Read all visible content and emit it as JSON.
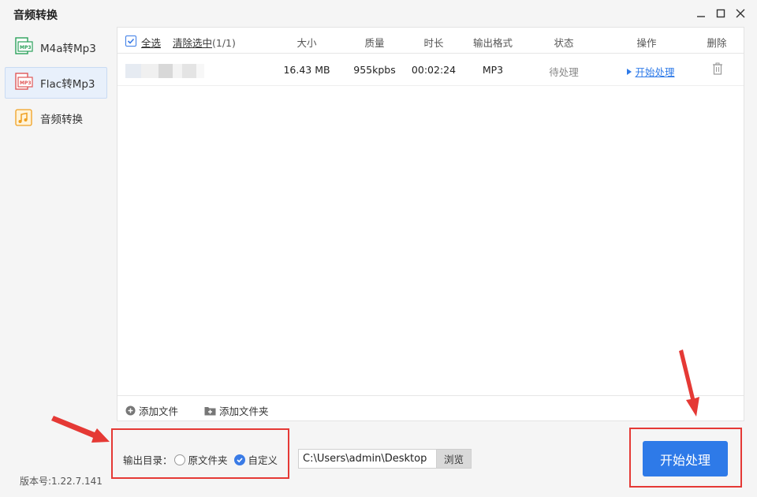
{
  "app": {
    "title": "音频转换"
  },
  "window": {
    "minimize": "minimize-icon",
    "maximize": "maximize-icon",
    "close": "close-icon"
  },
  "sidebar": {
    "items": [
      {
        "label": "M4a转Mp3",
        "icon": "mp3-file-icon",
        "active": false
      },
      {
        "label": "Flac转Mp3",
        "icon": "mp3-file-icon",
        "active": true
      },
      {
        "label": "音频转换",
        "icon": "music-note-icon",
        "active": false
      }
    ]
  },
  "table": {
    "select_all": "全选",
    "clear_selected": "清除选中",
    "selected_count": "(1/1)",
    "columns": [
      "大小",
      "质量",
      "时长",
      "输出格式",
      "状态",
      "操作",
      "删除"
    ],
    "rows": [
      {
        "size": "16.43 MB",
        "quality": "955kpbs",
        "duration": "00:02:24",
        "format": "MP3",
        "status": "待处理",
        "action": "开始处理"
      }
    ]
  },
  "footer": {
    "add_file": "添加文件",
    "add_folder": "添加文件夹"
  },
  "output": {
    "label": "输出目录：",
    "option_original": "原文件夹",
    "option_custom": "自定义",
    "selected": "custom",
    "path": "C:\\Users\\admin\\Desktop",
    "browse": "浏览"
  },
  "start_button": "开始处理",
  "version": "版本号:1.22.7.141",
  "colors": {
    "accent": "#2e7ae8",
    "highlight": "#e53935"
  }
}
